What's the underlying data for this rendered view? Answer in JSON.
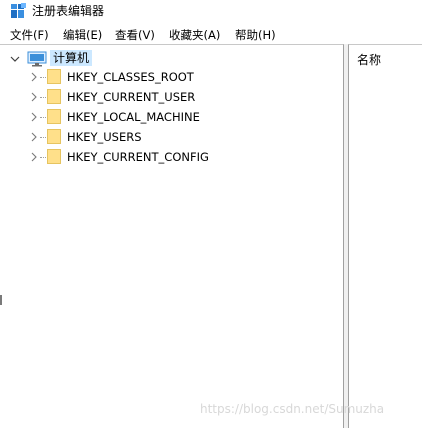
{
  "window": {
    "title": "注册表编辑器",
    "icon": "registry-editor-icon"
  },
  "menu": {
    "items": [
      {
        "label": "文件(F)"
      },
      {
        "label": "编辑(E)"
      },
      {
        "label": "查看(V)"
      },
      {
        "label": "收藏夹(A)"
      },
      {
        "label": "帮助(H)"
      }
    ]
  },
  "tree": {
    "root": {
      "label": "计算机",
      "icon": "computer-icon",
      "expanded": true,
      "selected": true
    },
    "items": [
      {
        "label": "HKEY_CLASSES_ROOT",
        "icon": "folder-icon"
      },
      {
        "label": "HKEY_CURRENT_USER",
        "icon": "folder-icon"
      },
      {
        "label": "HKEY_LOCAL_MACHINE",
        "icon": "folder-icon"
      },
      {
        "label": "HKEY_USERS",
        "icon": "folder-icon"
      },
      {
        "label": "HKEY_CURRENT_CONFIG",
        "icon": "folder-icon"
      }
    ]
  },
  "list": {
    "columns": [
      {
        "label": "名称"
      }
    ]
  },
  "watermark": "https://blog.csdn.net/Sumuzha",
  "colors": {
    "selection": "#cce8ff",
    "folder": "#ffe08a",
    "computer": "#3c8fd9"
  }
}
